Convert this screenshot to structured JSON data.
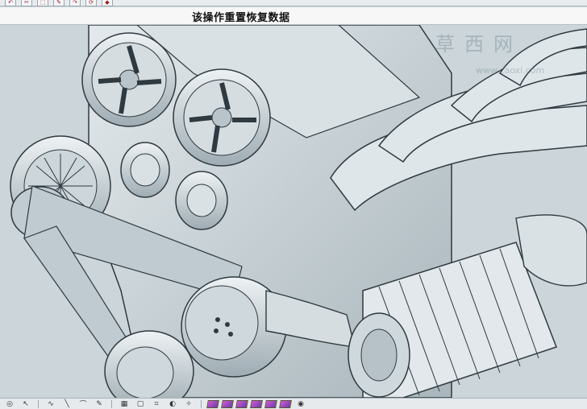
{
  "window": {
    "title": "该操作重置恢复数据"
  },
  "toolbar_top": {
    "buttons": [
      {
        "icon": "undo-icon",
        "glyph": "↶"
      },
      {
        "icon": "cut-icon",
        "glyph": "✂"
      },
      {
        "icon": "select-icon",
        "glyph": "⬚"
      },
      {
        "icon": "pencil-icon",
        "glyph": "✎"
      },
      {
        "icon": "redo-icon",
        "glyph": "↷"
      },
      {
        "icon": "refresh-icon",
        "glyph": "⟳"
      },
      {
        "icon": "cube-icon",
        "glyph": "◆"
      }
    ]
  },
  "watermark": {
    "main": "草西网",
    "sub": "www.caoxi.com"
  },
  "toolbar_bottom": {
    "left_icons": [
      "snap-icon",
      "pointer-icon",
      "curve-icon",
      "line-icon",
      "arc-icon",
      "sketch-icon",
      "grid-icon",
      "box-icon",
      "wire-icon",
      "shade-icon",
      "light-icon"
    ],
    "view_cubes": [
      "view-iso-icon",
      "view-front-icon",
      "view-top-icon",
      "view-right-icon",
      "view-left-icon",
      "view-back-icon"
    ],
    "right_icon": "render-sphere-icon"
  },
  "colors": {
    "model_fill": "#cfd8dd",
    "model_edge": "#2f3a40",
    "background": "#c9d3d8"
  }
}
